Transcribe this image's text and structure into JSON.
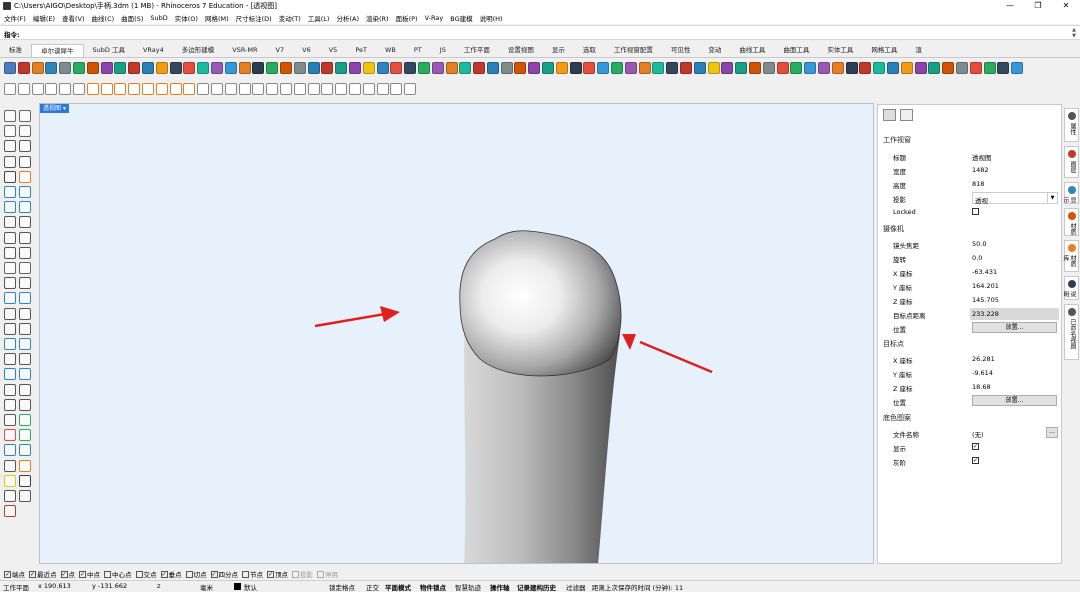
{
  "window": {
    "title": "C:\\Users\\AIGO\\Desktop\\手柄.3dm (1 MB) - Rhinoceros 7 Education - [透视图]",
    "minimize": "—",
    "maximize": "❐",
    "close": "✕"
  },
  "menu": [
    "文件(F)",
    "编辑(E)",
    "查看(V)",
    "曲线(C)",
    "曲面(S)",
    "SubD",
    "实体(O)",
    "网格(M)",
    "尺寸标注(D)",
    "变动(T)",
    "工具(L)",
    "分析(A)",
    "渲染(R)",
    "面板(P)",
    "V-Ray",
    "BG建模",
    "说明(H)"
  ],
  "command": {
    "label": "指令:",
    "value": ""
  },
  "tabs": [
    "标准",
    "卓尔谟犀牛",
    "SubD 工具",
    "VRay4",
    "多边形建模",
    "VSR-MR",
    "V7",
    "V6",
    "V5",
    "PeT",
    "WB",
    "PT",
    "JS",
    "工作平面",
    "设置视图",
    "显示",
    "选取",
    "工作视窗配置",
    "可见性",
    "变动",
    "曲线工具",
    "曲面工具",
    "实体工具",
    "网格工具",
    "渲"
  ],
  "active_tab_index": 1,
  "icons": {
    "row1_colors": [
      "#4c7dbf",
      "#c0392b",
      "#e67e22",
      "#2e86c1",
      "#7f8c8d",
      "#27ae60",
      "#d35400",
      "#8e44ad",
      "#16a085",
      "#c0392b",
      "#2980b9",
      "#f39c12",
      "#34495e",
      "#e74c3c",
      "#1abc9c",
      "#9b59b6",
      "#3498db",
      "#e67e22",
      "#2c3e50",
      "#27ae60",
      "#d35400",
      "#7f8c8d",
      "#2980b9",
      "#c0392b",
      "#16a085",
      "#8e44ad",
      "#f1c40f",
      "#2e86c1",
      "#e74c3c",
      "#34495e",
      "#27ae60",
      "#9b59b6",
      "#e67e22",
      "#1abc9c",
      "#c0392b",
      "#2980b9",
      "#7f8c8d",
      "#d35400",
      "#8e44ad",
      "#16a085",
      "#f39c12",
      "#2c3e50",
      "#e74c3c",
      "#3498db",
      "#27ae60",
      "#9b59b6",
      "#e67e22",
      "#1abc9c",
      "#34495e",
      "#c0392b",
      "#2980b9",
      "#f1c40f",
      "#8e44ad",
      "#16a085",
      "#d35400",
      "#7f8c8d",
      "#e74c3c",
      "#27ae60",
      "#3498db",
      "#9b59b6",
      "#e67e22",
      "#2c3e50",
      "#c0392b",
      "#1abc9c",
      "#2980b9",
      "#f39c12",
      "#8e44ad",
      "#16a085",
      "#d35400",
      "#7f8c8d",
      "#e74c3c",
      "#27ae60",
      "#34495e",
      "#3498db"
    ],
    "row2_colors": [
      "#888",
      "#888",
      "#888",
      "#888",
      "#888",
      "#888",
      "#e67e22",
      "#e67e22",
      "#e67e22",
      "#e67e22",
      "#e67e22",
      "#e67e22",
      "#e67e22",
      "#e67e22",
      "#888",
      "#888",
      "#888",
      "#888",
      "#888",
      "#888",
      "#888",
      "#888",
      "#888",
      "#888",
      "#888",
      "#888",
      "#888",
      "#888",
      "#888",
      "#888"
    ]
  },
  "viewport": {
    "label": "透视图 ▾"
  },
  "properties": {
    "sections": {
      "viewport": "工作视窗",
      "camera": "摄像机",
      "target": "目标点",
      "wallpaper": "底色图案"
    },
    "viewport_rows": [
      {
        "key": "标题",
        "value": "透视图"
      },
      {
        "key": "宽度",
        "value": "1482"
      },
      {
        "key": "高度",
        "value": "818"
      }
    ],
    "projection": {
      "key": "投影",
      "value": "透视"
    },
    "locked": {
      "key": "Locked",
      "checked": false
    },
    "camera_rows": [
      {
        "key": "镜头焦距",
        "value": "50.0"
      },
      {
        "key": "旋转",
        "value": "0.0"
      },
      {
        "key": "X 座标",
        "value": "-63.431"
      },
      {
        "key": "Y 座标",
        "value": "164.201"
      },
      {
        "key": "Z 座标",
        "value": "145.705"
      }
    ],
    "target_distance": {
      "key": "目标点距离",
      "value": "233.228"
    },
    "camera_position": {
      "key": "位置",
      "button": "放置..."
    },
    "target_rows": [
      {
        "key": "X 座标",
        "value": "26.281"
      },
      {
        "key": "Y 座标",
        "value": "-9.614"
      },
      {
        "key": "Z 座标",
        "value": "18.68"
      }
    ],
    "target_position": {
      "key": "位置",
      "button": "放置..."
    },
    "wallpaper_file": {
      "key": "文件名称",
      "value": "(无)",
      "button": "..."
    },
    "wallpaper_show": {
      "key": "显示",
      "checked": true
    },
    "wallpaper_gray": {
      "key": "灰阶",
      "checked": true
    }
  },
  "right_panel_tabs": [
    {
      "label": "属性",
      "color": "#555"
    },
    {
      "label": "图层",
      "color": "#c0392b"
    },
    {
      "label": "显示",
      "color": "#2e86c1"
    },
    {
      "label": "材质",
      "color": "#d35400"
    },
    {
      "label": "材质库",
      "color": "#e67e22"
    },
    {
      "label": "说明",
      "color": "#2c3e50"
    },
    {
      "label": "已命名视图",
      "color": "#555"
    }
  ],
  "osnaps": [
    {
      "label": "端点",
      "checked": true
    },
    {
      "label": "最近点",
      "checked": true
    },
    {
      "label": "点",
      "checked": true
    },
    {
      "label": "中点",
      "checked": true
    },
    {
      "label": "中心点",
      "checked": false
    },
    {
      "label": "交点",
      "checked": false
    },
    {
      "label": "垂点",
      "checked": true
    },
    {
      "label": "切点",
      "checked": false
    },
    {
      "label": "四分点",
      "checked": true
    },
    {
      "label": "节点",
      "checked": false
    },
    {
      "label": "顶点",
      "checked": true
    },
    {
      "label": "投影",
      "checked": false,
      "disabled": true
    },
    {
      "label": "停用",
      "checked": false,
      "disabled": true
    }
  ],
  "status": {
    "cplane": "工作平面",
    "x": "x 190.613",
    "y": "y -131.662",
    "z": "z",
    "unit": "毫米",
    "layer": "默认",
    "lock_grid": "锁定格点",
    "ortho": "正交",
    "planar": "平面模式",
    "osnap": "物件锁点",
    "smarttrack": "智慧轨迹",
    "gumball": "操作轴",
    "history": "记录建构历史",
    "filter": "过滤器",
    "autosave": "距离上次保存的时间 (分钟): 11"
  }
}
